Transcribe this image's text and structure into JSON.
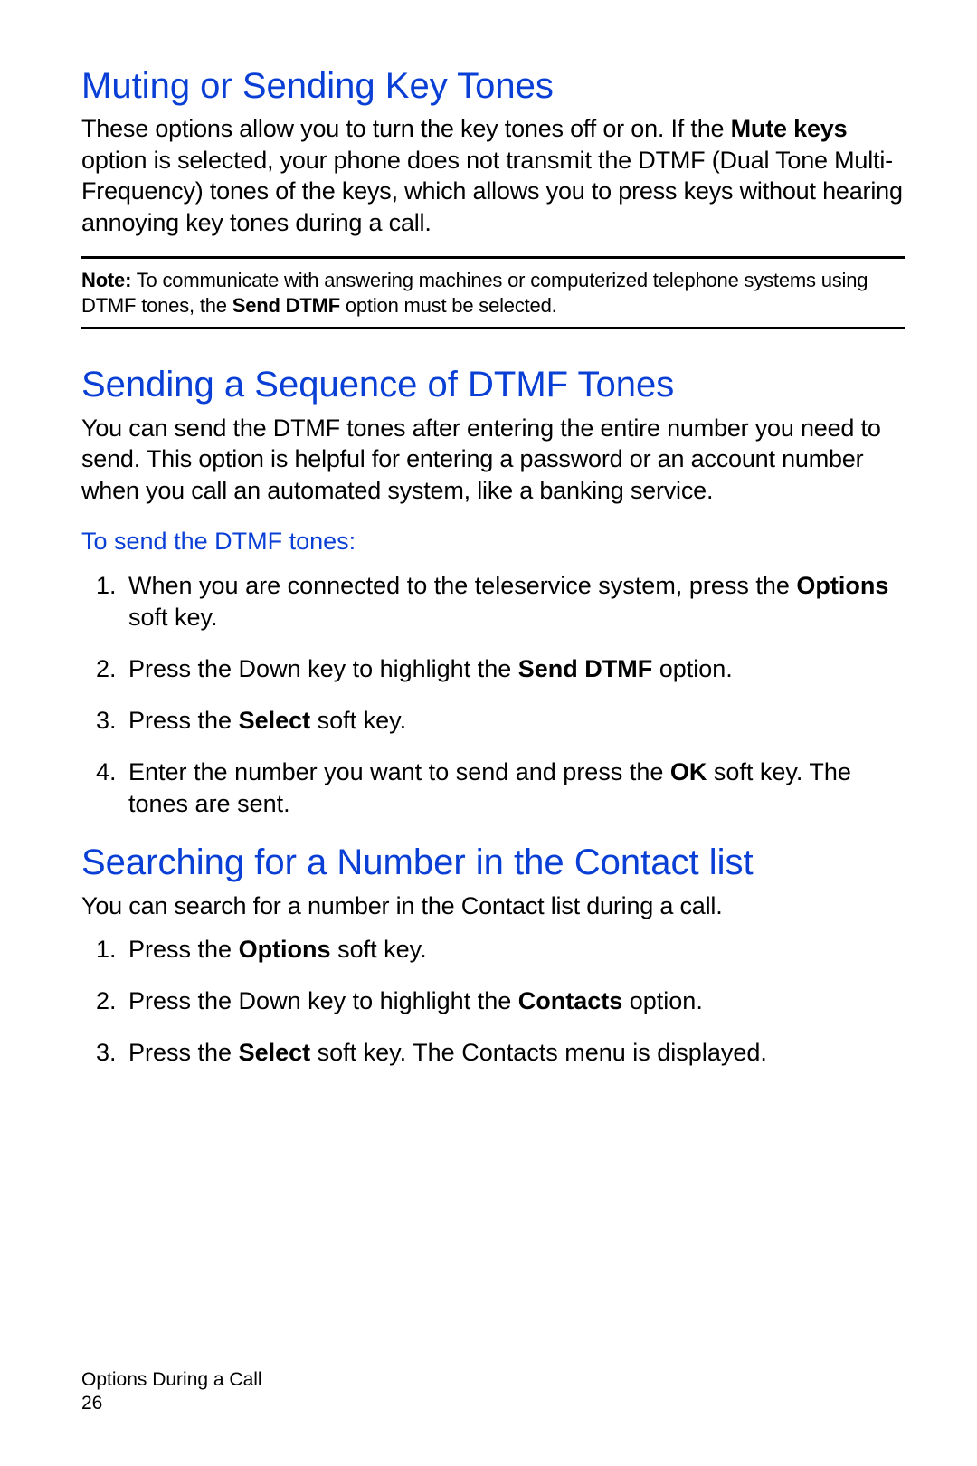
{
  "section1": {
    "heading": "Muting or Sending Key Tones",
    "para_parts": {
      "a": "These options allow you to turn the key tones off or on. If the ",
      "b": "Mute keys",
      "c": " option is selected, your phone does not transmit the DTMF (Dual Tone Multi-Frequency) tones of the keys, which allows you to press keys without hearing annoying key tones during a call."
    },
    "note": {
      "label": "Note:",
      "text_a": " To communicate with answering machines or computerized telephone systems using DTMF tones, the ",
      "bold": "Send DTMF",
      "text_b": " option must be selected."
    }
  },
  "section2": {
    "heading": "Sending a Sequence of DTMF Tones",
    "para": "You can send the DTMF tones after entering the entire number you need to send. This option is helpful for entering a password or an account number when you call an automated system, like a banking service.",
    "subhead": "To send the DTMF tones:",
    "steps": {
      "s1a": "When you are connected to the teleservice system, press the ",
      "s1b": "Options",
      "s1c": " soft key.",
      "s2a": "Press the Down key to highlight the ",
      "s2b": "Send DTMF",
      "s2c": " option.",
      "s3a": "Press the ",
      "s3b": "Select",
      "s3c": " soft key.",
      "s4a": "Enter the number you want to send and press the ",
      "s4b": "OK",
      "s4c": " soft key. The tones are sent."
    }
  },
  "section3": {
    "heading": "Searching for a Number in the Contact list",
    "para": "You can search for a number in the Contact list during a call.",
    "steps": {
      "s1a": "Press the ",
      "s1b": "Options",
      "s1c": " soft key.",
      "s2a": "Press the Down key to highlight the ",
      "s2b": "Contacts",
      "s2c": " option.",
      "s3a": "Press the ",
      "s3b": "Select",
      "s3c": " soft key. The Contacts menu is displayed."
    }
  },
  "footer": {
    "section_name": "Options During a Call",
    "page_number": "26"
  }
}
